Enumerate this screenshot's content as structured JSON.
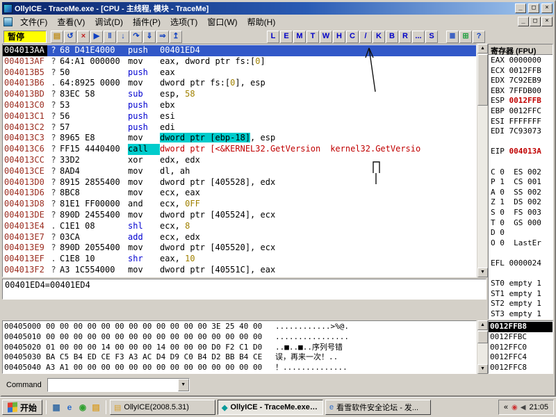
{
  "window": {
    "title": "OllyICE - TraceMe.exe - [CPU - 主线程, 模块 - TraceMe]",
    "minimize": "_",
    "maximize": "□",
    "close": "×"
  },
  "menu": {
    "items": [
      "文件(F)",
      "查看(V)",
      "调试(D)",
      "插件(P)",
      "选项(T)",
      "窗口(W)",
      "帮助(H)"
    ]
  },
  "status": {
    "paused": "暂停"
  },
  "toolbar": {
    "icon_buttons": [
      {
        "name": "open-file",
        "glyph": "▤",
        "color": "#c09020"
      },
      {
        "name": "restart",
        "glyph": "↺",
        "color": "#1040c0"
      },
      {
        "name": "close-program",
        "glyph": "×",
        "color": "#c02020"
      },
      {
        "name": "run",
        "glyph": "▶",
        "color": "#1040c0"
      },
      {
        "name": "pause",
        "glyph": "‖",
        "color": "#1040c0"
      },
      {
        "name": "step-into",
        "glyph": "↓",
        "color": "#1040c0"
      },
      {
        "name": "step-over",
        "glyph": "↷",
        "color": "#1040c0"
      },
      {
        "name": "trace-into",
        "glyph": "⇓",
        "color": "#1040c0"
      },
      {
        "name": "trace-over",
        "glyph": "⇒",
        "color": "#1040c0"
      },
      {
        "name": "execute-till-return",
        "glyph": "↥",
        "color": "#1040c0"
      }
    ],
    "letter_buttons": [
      "L",
      "E",
      "M",
      "T",
      "W",
      "H",
      "C",
      "/",
      "K",
      "B",
      "R",
      "...",
      "S"
    ],
    "right_buttons": [
      {
        "name": "appearance",
        "glyph": "≣",
        "color": "#1040c0"
      },
      {
        "name": "windows-list",
        "glyph": "⊞",
        "color": "#20a040"
      },
      {
        "name": "help",
        "glyph": "?",
        "color": "#1040c0"
      }
    ]
  },
  "disassembly": {
    "rows": [
      {
        "address": "004013AA",
        "flag": "?",
        "bytes": "68 D41E4000",
        "mn": "push",
        "mnc": "blue",
        "ops": [
          [
            "00401ED4",
            "num"
          ]
        ],
        "sel": true
      },
      {
        "address": "004013AF",
        "flag": "?",
        "bytes": "64:A1 000000",
        "mn": "mov",
        "mnc": "",
        "ops": [
          [
            "eax, dword ptr fs:[",
            ""
          ],
          [
            "0",
            "num"
          ],
          [
            "]",
            ""
          ]
        ]
      },
      {
        "address": "004013B5",
        "flag": "?",
        "bytes": "50",
        "mn": "push",
        "mnc": "blue",
        "ops": [
          [
            "eax",
            ""
          ]
        ]
      },
      {
        "address": "004013B6",
        "flag": ".",
        "bytes": "64:8925 0000",
        "mn": "mov",
        "mnc": "",
        "ops": [
          [
            "dword ptr fs:[",
            ""
          ],
          [
            "0",
            "num"
          ],
          [
            "], esp",
            ""
          ]
        ]
      },
      {
        "address": "004013BD",
        "flag": "?",
        "bytes": "83EC 58",
        "mn": "sub",
        "mnc": "blue",
        "ops": [
          [
            "esp, ",
            ""
          ],
          [
            "58",
            "num"
          ]
        ]
      },
      {
        "address": "004013C0",
        "flag": "?",
        "bytes": "53",
        "mn": "push",
        "mnc": "blue",
        "ops": [
          [
            "ebx",
            ""
          ]
        ]
      },
      {
        "address": "004013C1",
        "flag": "?",
        "bytes": "56",
        "mn": "push",
        "mnc": "blue",
        "ops": [
          [
            "esi",
            ""
          ]
        ]
      },
      {
        "address": "004013C2",
        "flag": "?",
        "bytes": "57",
        "mn": "push",
        "mnc": "blue",
        "ops": [
          [
            "edi",
            ""
          ]
        ]
      },
      {
        "address": "004013C3",
        "flag": "?",
        "bytes": "8965 E8",
        "mn": "mov",
        "mnc": "",
        "ops": [
          [
            "dword ptr [ebp-18]",
            "hl-cyan"
          ],
          [
            ", esp",
            ""
          ]
        ]
      },
      {
        "address": "004013C6",
        "flag": "?",
        "bytes": "FF15 4440400",
        "mn": "call",
        "mnc": "hl-cyan",
        "ops": [
          [
            "dword ptr [<&KERNEL32.GetVersion",
            "red"
          ]
        ],
        "comment": "kernel32.GetVersio",
        "commentc": "red"
      },
      {
        "address": "004013CC",
        "flag": "?",
        "bytes": "33D2",
        "mn": "xor",
        "mnc": "",
        "ops": [
          [
            "edx, edx",
            ""
          ]
        ]
      },
      {
        "address": "004013CE",
        "flag": "?",
        "bytes": "8AD4",
        "mn": "mov",
        "mnc": "",
        "ops": [
          [
            "dl, ah",
            ""
          ]
        ]
      },
      {
        "address": "004013D0",
        "flag": "?",
        "bytes": "8915 2855400",
        "mn": "mov",
        "mnc": "",
        "ops": [
          [
            "dword ptr [405528], edx",
            ""
          ]
        ]
      },
      {
        "address": "004013D6",
        "flag": "?",
        "bytes": "8BC8",
        "mn": "mov",
        "mnc": "",
        "ops": [
          [
            "ecx, eax",
            ""
          ]
        ]
      },
      {
        "address": "004013D8",
        "flag": "?",
        "bytes": "81E1 FF00000",
        "mn": "and",
        "mnc": "",
        "ops": [
          [
            "ecx, ",
            ""
          ],
          [
            "0FF",
            "num"
          ]
        ]
      },
      {
        "address": "004013DE",
        "flag": "?",
        "bytes": "890D 2455400",
        "mn": "mov",
        "mnc": "",
        "ops": [
          [
            "dword ptr [405524], ecx",
            ""
          ]
        ]
      },
      {
        "address": "004013E4",
        "flag": ".",
        "bytes": "C1E1 08",
        "mn": "shl",
        "mnc": "blue",
        "ops": [
          [
            "ecx, ",
            ""
          ],
          [
            "8",
            "num"
          ]
        ]
      },
      {
        "address": "004013E7",
        "flag": "?",
        "bytes": "03CA",
        "mn": "add",
        "mnc": "blue",
        "ops": [
          [
            "ecx, edx",
            ""
          ]
        ]
      },
      {
        "address": "004013E9",
        "flag": "?",
        "bytes": "890D 2055400",
        "mn": "mov",
        "mnc": "",
        "ops": [
          [
            "dword ptr [405520], ecx",
            ""
          ]
        ]
      },
      {
        "address": "004013EF",
        "flag": ".",
        "bytes": "C1E8 10",
        "mn": "shr",
        "mnc": "blue",
        "ops": [
          [
            "eax, ",
            ""
          ],
          [
            "10",
            "num"
          ]
        ]
      },
      {
        "address": "004013F2",
        "flag": "?",
        "bytes": "A3 1C554000",
        "mn": "mov",
        "mnc": "",
        "ops": [
          [
            "dword ptr [40551C], eax",
            ""
          ]
        ]
      }
    ]
  },
  "info_pane": {
    "text": "00401ED4=00401ED4"
  },
  "registers": {
    "title": "寄存器 (FPU)",
    "gprs": [
      {
        "name": "EAX",
        "value": "0000000",
        "red": false
      },
      {
        "name": "ECX",
        "value": "0012FFB",
        "red": false
      },
      {
        "name": "EDX",
        "value": "7C92EB9",
        "red": false
      },
      {
        "name": "EBX",
        "value": "7FFDB00",
        "red": false
      },
      {
        "name": "ESP",
        "value": "0012FFB",
        "red": true
      },
      {
        "name": "EBP",
        "value": "0012FFC",
        "red": false
      },
      {
        "name": "ESI",
        "value": "FFFFFFF",
        "red": false
      },
      {
        "name": "EDI",
        "value": "7C93073",
        "red": false
      }
    ],
    "eip": {
      "name": "EIP",
      "value": "004013A",
      "red": true
    },
    "flags": [
      {
        "flag": "C",
        "value": "0",
        "seg": "ES",
        "segval": "002"
      },
      {
        "flag": "P",
        "value": "1",
        "seg": "CS",
        "segval": "001"
      },
      {
        "flag": "A",
        "value": "0",
        "seg": "SS",
        "segval": "002"
      },
      {
        "flag": "Z",
        "value": "1",
        "seg": "DS",
        "segval": "002"
      },
      {
        "flag": "S",
        "value": "0",
        "seg": "FS",
        "segval": "003"
      },
      {
        "flag": "T",
        "value": "0",
        "seg": "GS",
        "segval": "000"
      },
      {
        "flag": "D",
        "value": "0",
        "seg": "",
        "segval": ""
      },
      {
        "flag": "O",
        "value": "0",
        "seg": "LastEr",
        "segval": ""
      }
    ],
    "efl": "EFL 0000024",
    "fpu": [
      "ST0 empty 1",
      "ST1 empty 1",
      "ST2 empty 1",
      "ST3 empty 1"
    ]
  },
  "dump": {
    "rows": [
      {
        "address": "00405000",
        "hex": "00 00 00 00 00 00 00 00 00 00 00 00 3E 25 40 00",
        "ascii": "............>%@."
      },
      {
        "address": "00405010",
        "hex": "00 00 00 00 00 00 00 00 00 00 00 00 00 00 00 00",
        "ascii": "................"
      },
      {
        "address": "00405020",
        "hex": "01 00 00 00 14 00 00 00 14 00 00 00 D0 F2 C1 D0",
        "ascii": "..■..■..序列号错"
      },
      {
        "address": "00405030",
        "hex": "BA C5 B4 ED CE F3 A3 AC D4 D9 C0 B4 D2 BB B4 CE",
        "ascii": "误，再来一次！.."
      },
      {
        "address": "00405040",
        "hex": "A3 A1 00 00 00 00 00 00 00 00 00 00 00 00 00 00",
        "ascii": "！.............."
      }
    ]
  },
  "stack": {
    "rows": [
      {
        "address": "0012FFB8",
        "selected": true
      },
      {
        "address": "0012FFBC",
        "selected": false
      },
      {
        "address": "0012FFC0",
        "selected": false
      },
      {
        "address": "0012FFC4",
        "selected": false
      },
      {
        "address": "0012FFC8",
        "selected": false
      }
    ]
  },
  "command_bar": {
    "label": "Command"
  },
  "taskbar": {
    "start_label": "开始",
    "quick_launch": [
      {
        "name": "show-desktop",
        "glyph": "▦",
        "color": "#3a6ea5"
      },
      {
        "name": "launch-ie",
        "glyph": "e",
        "color": "#2b6cc8"
      },
      {
        "name": "launch-media",
        "glyph": "◉",
        "color": "#30a030"
      },
      {
        "name": "launch-folder",
        "glyph": "▤",
        "color": "#d8a030"
      }
    ],
    "tasks": [
      {
        "name": "task-ollyice-folder",
        "icon": "▤",
        "icon_color": "#d8a030",
        "label": "OllyICE(2008.5.31)",
        "active": false
      },
      {
        "name": "task-ollyice-traceme",
        "icon": "◆",
        "icon_color": "#0a9a9a",
        "label": "OllyICE - TraceMe.exe - ...",
        "active": true
      },
      {
        "name": "task-pediy-forum",
        "icon": "e",
        "icon_color": "#2b6cc8",
        "label": "看雪软件安全论坛 - 发...",
        "active": false
      }
    ],
    "tray": {
      "chevron": "«",
      "icons": [
        {
          "name": "tray-antivirus-icon",
          "glyph": "◉",
          "color": "#cc3333"
        },
        {
          "name": "tray-volume-icon",
          "glyph": "◀",
          "color": "#444444"
        }
      ],
      "time": "21:05"
    }
  },
  "colors": {
    "window_chrome": "#d4d0c8",
    "titlebar_start": "#0a246a",
    "titlebar_end": "#a6caf0",
    "selection_blue": "#3158c8",
    "address_red": "#9b2d20",
    "mnemonic_blue": "#0000d0",
    "number_olive": "#a08000",
    "highlight_cyan": "#00cccc",
    "api_red": "#c00000",
    "paused_bg": "#ffff00"
  }
}
